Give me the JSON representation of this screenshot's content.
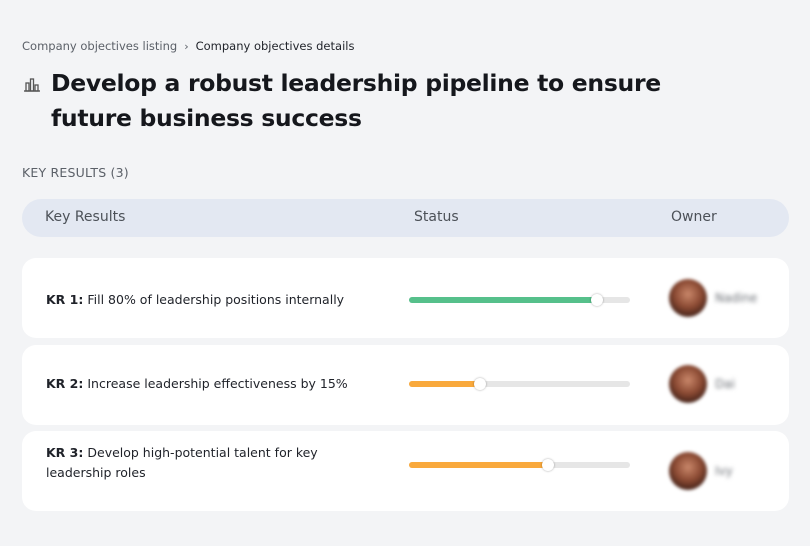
{
  "breadcrumb": {
    "parent": "Company objectives listing",
    "separator": "›",
    "current": "Company objectives details"
  },
  "objective": {
    "icon": "building-chart-icon",
    "title": "Develop a robust leadership pipeline to ensure future business success"
  },
  "key_results_label": "KEY RESULTS (3)",
  "table": {
    "headers": {
      "key_results": "Key Results",
      "status": "Status",
      "owner": "Owner"
    },
    "rows": [
      {
        "prefix": "KR 1:",
        "text": "Fill 80% of leadership positions internally",
        "progress": 0.85,
        "color": "#56c08b",
        "owner_name": "Nadine"
      },
      {
        "prefix": "KR 2:",
        "text": "Increase leadership effectiveness by 15%",
        "progress": 0.32,
        "color": "#f9a93c",
        "owner_name": "Dai"
      },
      {
        "prefix": "KR 3:",
        "text": "Develop high-potential talent for key leadership roles",
        "progress": 0.63,
        "color": "#f9a93c",
        "owner_name": "Ivy"
      }
    ]
  }
}
